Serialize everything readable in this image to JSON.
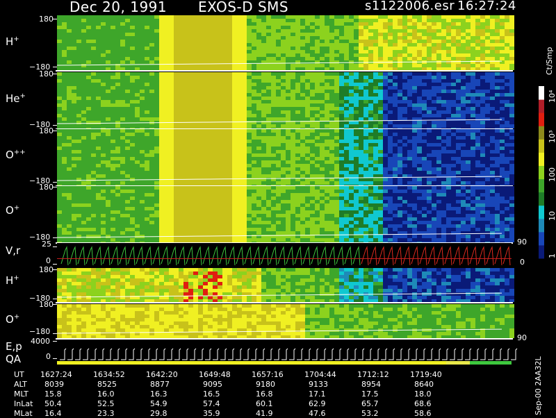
{
  "header": {
    "date": "Dec 20, 1991",
    "instrument": "EXOS-D SMS",
    "file": "s1122006.esr",
    "time": "16:27:24"
  },
  "colors": {
    "background": "#000000",
    "scale": [
      "#0a1a78",
      "#1846b8",
      "#1e8ab8",
      "#10c8d0",
      "#1e7c28",
      "#3ea62a",
      "#8cd21e",
      "#f0f022",
      "#c8c21a",
      "#8c8a1c",
      "#e01e10",
      "#b01e28",
      "#ffffff"
    ]
  },
  "colorbar": {
    "title": "Ct/Smp",
    "ticks": [
      "1",
      "10",
      "100",
      "10³",
      "10⁴"
    ]
  },
  "chart_data": {
    "type": "heatmap",
    "panels": [
      {
        "label": "H",
        "sup": "+",
        "ytop": "180",
        "ybot": "−180"
      },
      {
        "label": "He",
        "sup": "+",
        "ytop": "180",
        "ybot": "−180"
      },
      {
        "label": "O",
        "sup": "++",
        "ytop": "180",
        "ybot": "−180"
      },
      {
        "label": "O",
        "sup": "+",
        "ytop": "180",
        "ybot": "−180",
        "right": "90"
      },
      {
        "label": "V,r",
        "sup": "",
        "ytop": "25",
        "ybot": "0",
        "right": "0"
      },
      {
        "label": "H",
        "sup": "+",
        "ytop": "180",
        "ybot": "−180"
      },
      {
        "label": "O",
        "sup": "+",
        "ytop": "180",
        "ybot": "−180",
        "right": "90"
      },
      {
        "label": "E,p",
        "sup": "",
        "ytop": "4000",
        "ybot": "0"
      }
    ],
    "qa_label": "QA",
    "rows": [
      {
        "name": "UT",
        "values": [
          "1627:24",
          "1634:52",
          "1642:20",
          "1649:48",
          "1657:16",
          "1704:44",
          "1712:12",
          "1719:40"
        ]
      },
      {
        "name": "ALT",
        "values": [
          "8039",
          "8525",
          "8877",
          "9095",
          "9180",
          "9133",
          "8954",
          "8640"
        ]
      },
      {
        "name": "MLT",
        "values": [
          "15.8",
          "16.0",
          "16.3",
          "16.5",
          "16.8",
          "17.1",
          "17.5",
          "18.0"
        ]
      },
      {
        "name": "InLat",
        "values": [
          "50.4",
          "52.5",
          "54.9",
          "57.4",
          "60.1",
          "62.9",
          "65.7",
          "68.6"
        ]
      },
      {
        "name": "MLat",
        "values": [
          "16.4",
          "23.3",
          "29.8",
          "35.9",
          "41.9",
          "47.6",
          "53.2",
          "58.6"
        ]
      }
    ]
  },
  "footer_note": "Sep-00  2AA32L"
}
